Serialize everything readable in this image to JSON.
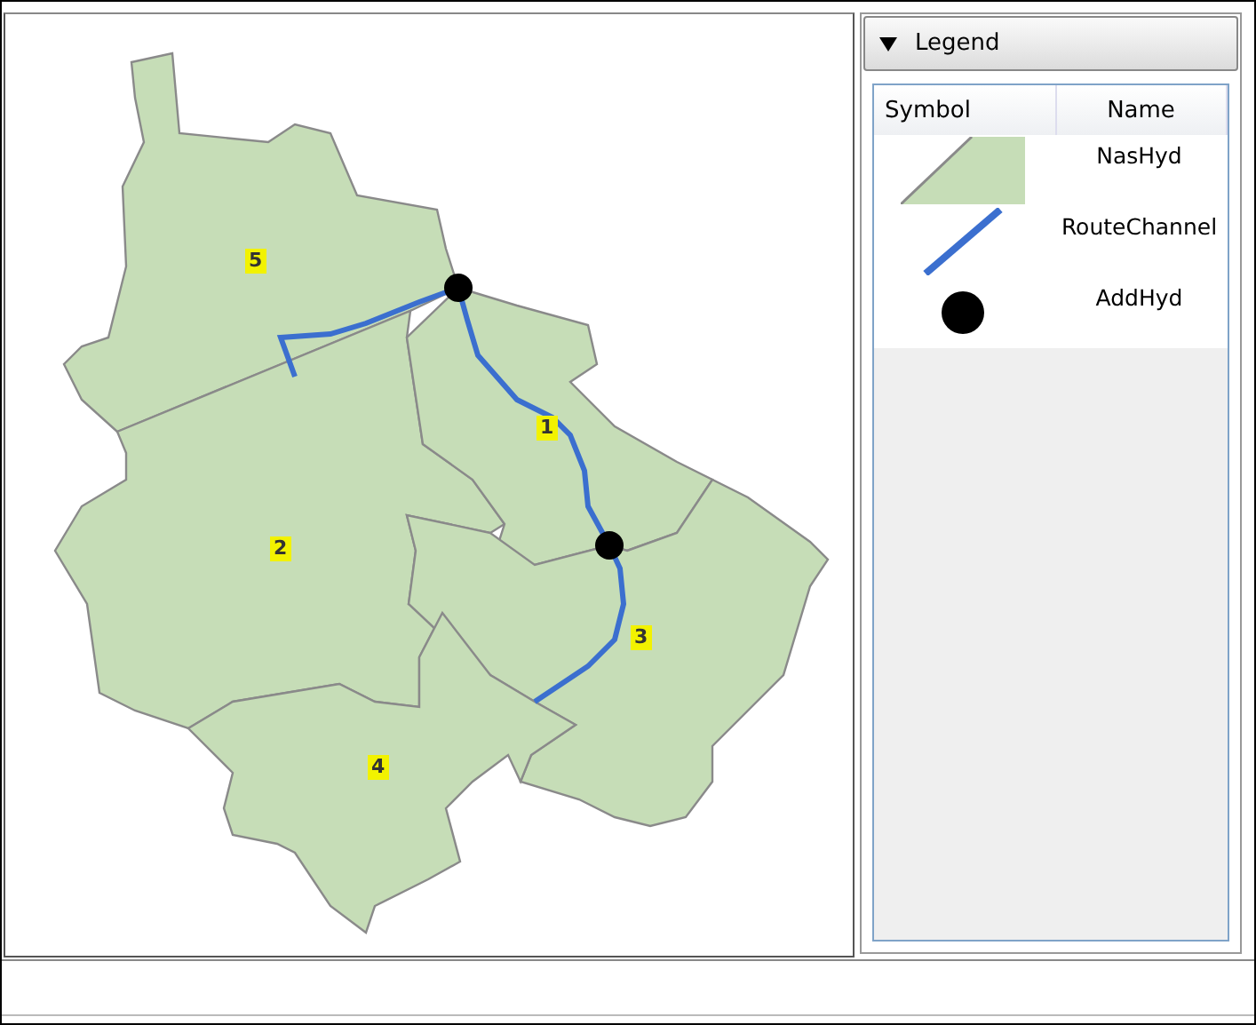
{
  "map": {
    "subbasins": [
      {
        "label": "5"
      },
      {
        "label": "2"
      },
      {
        "label": "1"
      },
      {
        "label": "3"
      },
      {
        "label": "4"
      }
    ]
  },
  "legend": {
    "title": "Legend",
    "expanded": true,
    "columns": [
      "Symbol",
      "Name"
    ],
    "rows": [
      {
        "kind": "polygon",
        "name": "NasHyd"
      },
      {
        "kind": "line",
        "name": "RouteChannel"
      },
      {
        "kind": "point",
        "name": "AddHyd"
      }
    ]
  }
}
